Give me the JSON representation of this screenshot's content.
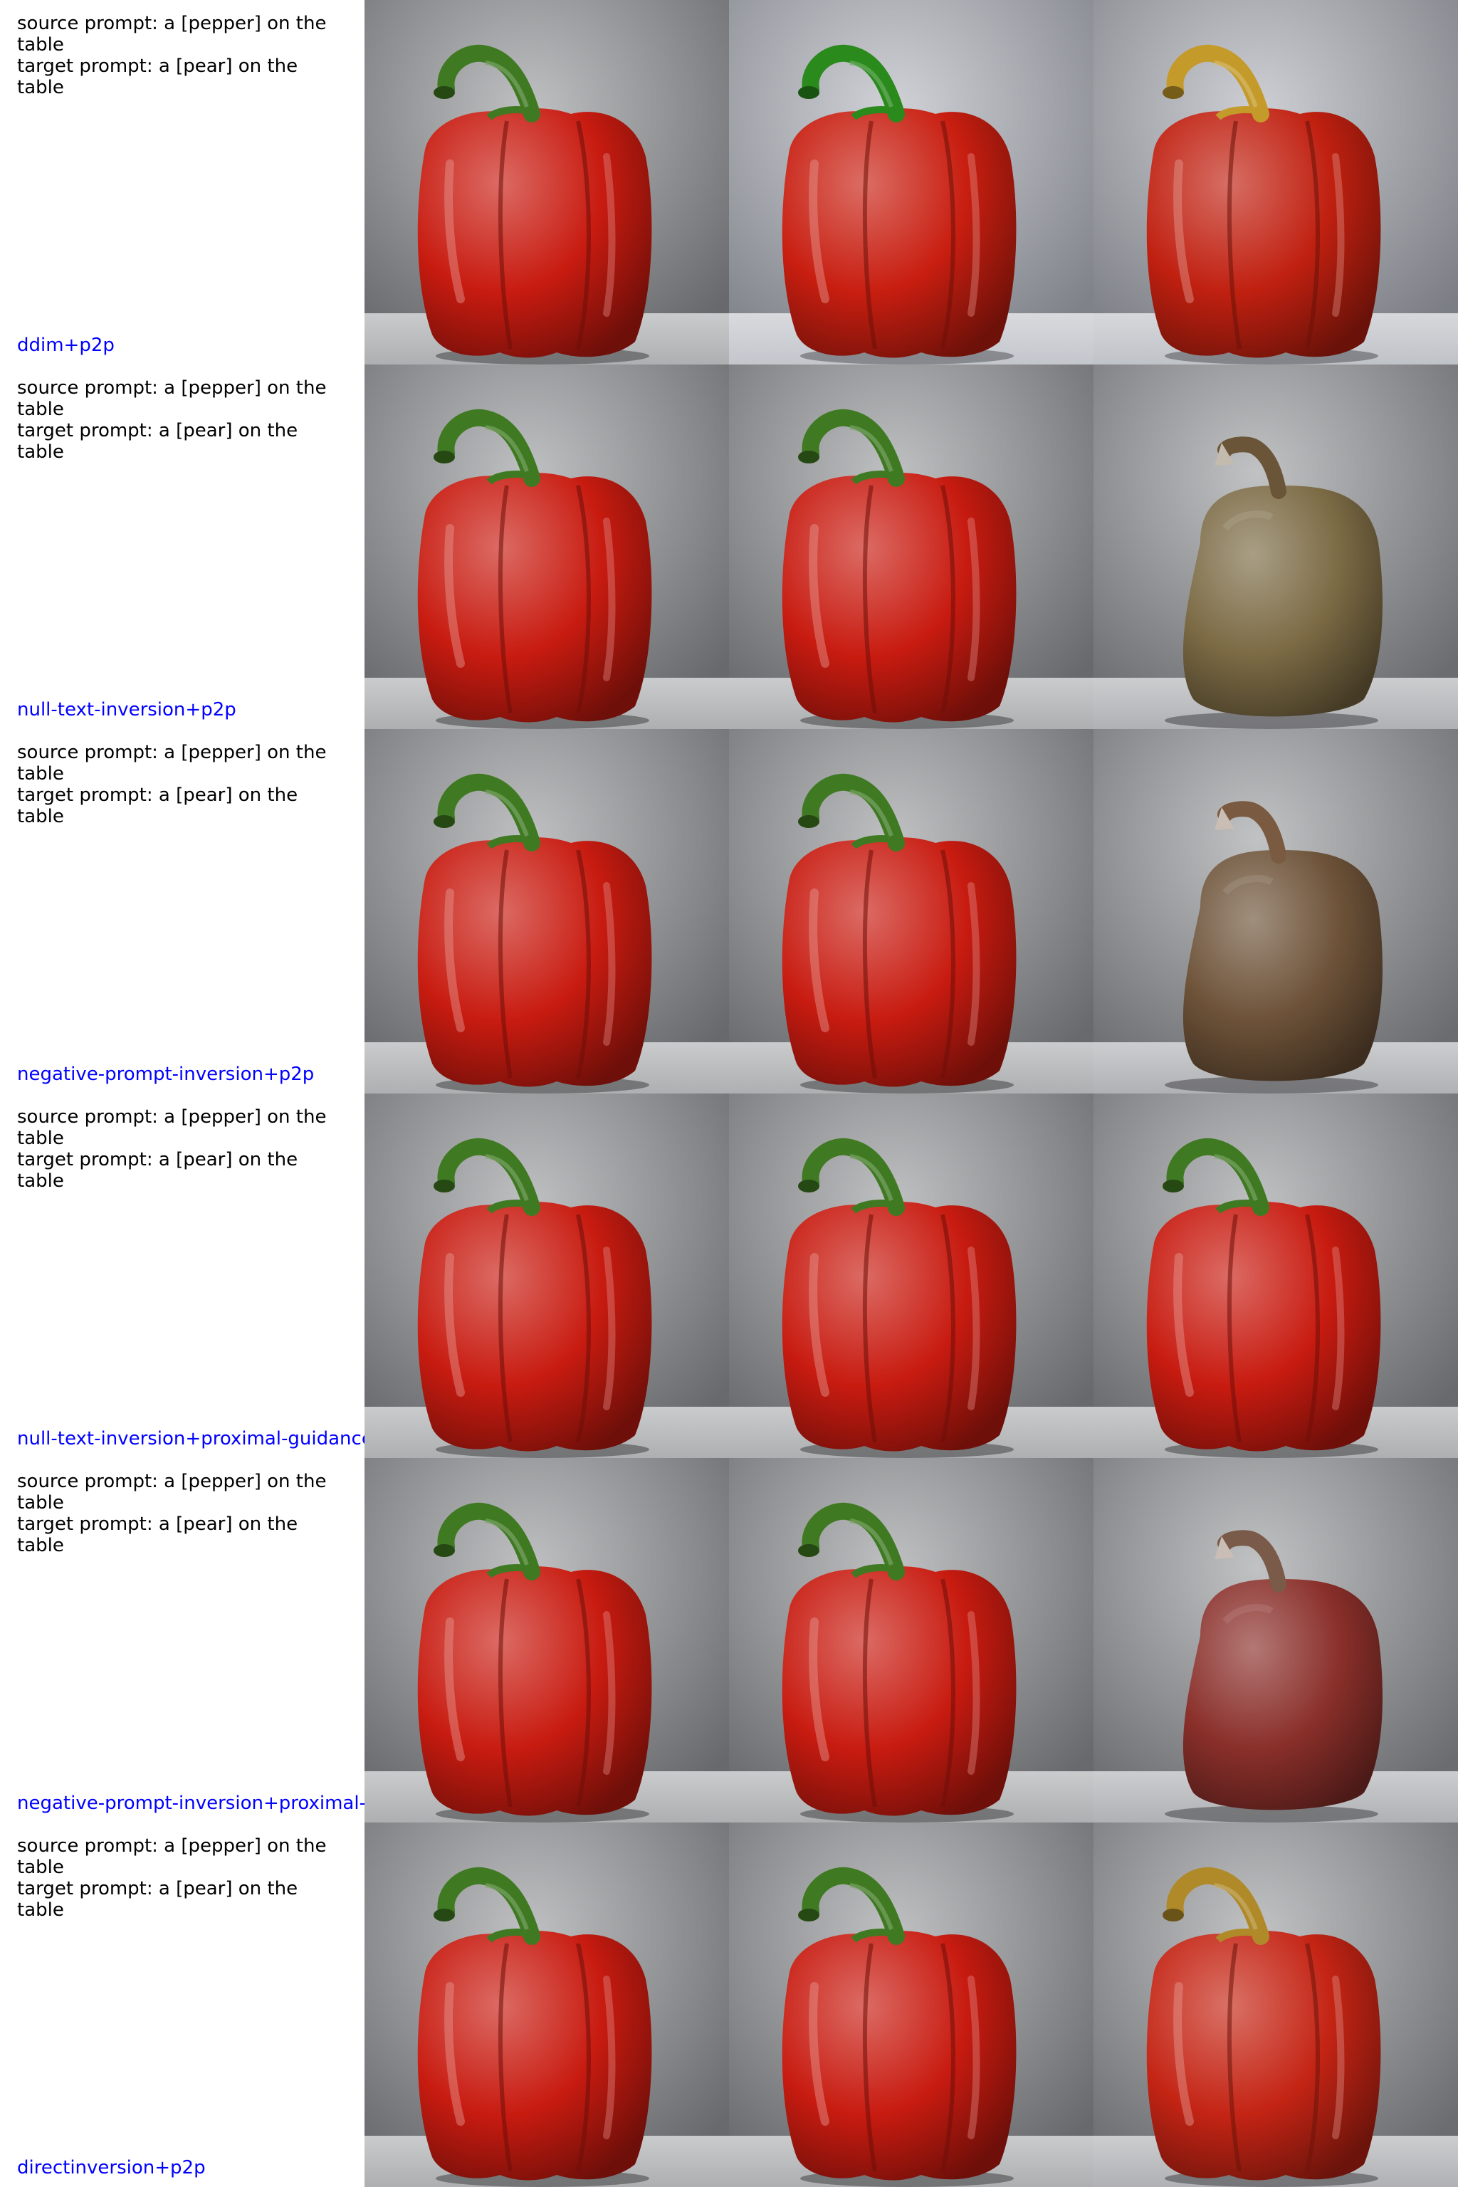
{
  "rows": [
    {
      "source_prompt": "source prompt: a [pepper] on the table",
      "target_prompt": "target prompt: a [pear] on the table",
      "method": "ddim+p2p",
      "images": [
        {
          "name": "source-pepper-image",
          "kind": "pepper",
          "bg": "#8a8c90",
          "body": "#c81b10",
          "stem": "#3f7a22"
        },
        {
          "name": "reconstructed-pepper-image",
          "kind": "pepper",
          "bg": "#a9adb6",
          "body": "#c81e10",
          "stem": "#2a8a1c"
        },
        {
          "name": "edited-pepper-image",
          "kind": "pepper",
          "bg": "#a4a8b0",
          "body": "#c02010",
          "stem": "#c49a2a"
        }
      ]
    },
    {
      "source_prompt": "source prompt: a [pepper] on the table",
      "target_prompt": "target prompt: a [pear] on the table",
      "method": "null-text-inversion+p2p",
      "images": [
        {
          "name": "source-pepper-image",
          "kind": "pepper",
          "bg": "#8a8c90",
          "body": "#c81b10",
          "stem": "#3f7a22"
        },
        {
          "name": "reconstructed-pepper-image",
          "kind": "pepper",
          "bg": "#8a8c90",
          "body": "#c81b10",
          "stem": "#3f7a22"
        },
        {
          "name": "edited-pear-image",
          "kind": "pear",
          "bg": "#8e9094",
          "body": "#7b6a44",
          "stem": "#6b5538"
        }
      ]
    },
    {
      "source_prompt": "source prompt: a [pepper] on the table",
      "target_prompt": "target prompt: a [pear] on the table",
      "method": "negative-prompt-inversion+p2p",
      "images": [
        {
          "name": "source-pepper-image",
          "kind": "pepper",
          "bg": "#8a8c90",
          "body": "#c81b10",
          "stem": "#3f7a22"
        },
        {
          "name": "reconstructed-pepper-image",
          "kind": "pepper",
          "bg": "#8a8c90",
          "body": "#c81b10",
          "stem": "#3f7a22"
        },
        {
          "name": "edited-pear-image",
          "kind": "pear",
          "bg": "#8e9094",
          "body": "#6d5238",
          "stem": "#7a5a40"
        }
      ]
    },
    {
      "source_prompt": "source prompt: a [pepper] on the table",
      "target_prompt": "target prompt: a [pear] on the table",
      "method": "null-text-inversion+proximal-guidance",
      "images": [
        {
          "name": "source-pepper-image",
          "kind": "pepper",
          "bg": "#8a8c90",
          "body": "#c81b10",
          "stem": "#3f7a22"
        },
        {
          "name": "reconstructed-pepper-image",
          "kind": "pepper",
          "bg": "#8a8c90",
          "body": "#c81b10",
          "stem": "#3f7a22"
        },
        {
          "name": "edited-pepper-image",
          "kind": "pepper",
          "bg": "#8a8c90",
          "body": "#c81b10",
          "stem": "#3f7a22"
        }
      ]
    },
    {
      "source_prompt": "source prompt: a [pepper] on the table",
      "target_prompt": "target prompt: a [pear] on the table",
      "method": "negative-prompt-inversion+proximal-guidance",
      "images": [
        {
          "name": "source-pepper-image",
          "kind": "pepper",
          "bg": "#8a8c90",
          "body": "#c81b10",
          "stem": "#3f7a22"
        },
        {
          "name": "reconstructed-pepper-image",
          "kind": "pepper",
          "bg": "#8a8c90",
          "body": "#c81b10",
          "stem": "#3f7a22"
        },
        {
          "name": "edited-pear-image",
          "kind": "pear",
          "bg": "#8e9094",
          "body": "#8a2f2a",
          "stem": "#7a5a48"
        }
      ]
    },
    {
      "source_prompt": "source prompt: a [pepper] on the table",
      "target_prompt": "target prompt: a [pear] on the table",
      "method": "directinversion+p2p",
      "images": [
        {
          "name": "source-pepper-image",
          "kind": "pepper",
          "bg": "#8a8c90",
          "body": "#c81b10",
          "stem": "#3f7a22"
        },
        {
          "name": "reconstructed-pepper-image",
          "kind": "pepper",
          "bg": "#8a8c90",
          "body": "#c81b10",
          "stem": "#3f7a22"
        },
        {
          "name": "edited-pepper-image",
          "kind": "pepper",
          "bg": "#8e9094",
          "body": "#c42414",
          "stem": "#b08a28"
        }
      ]
    }
  ]
}
